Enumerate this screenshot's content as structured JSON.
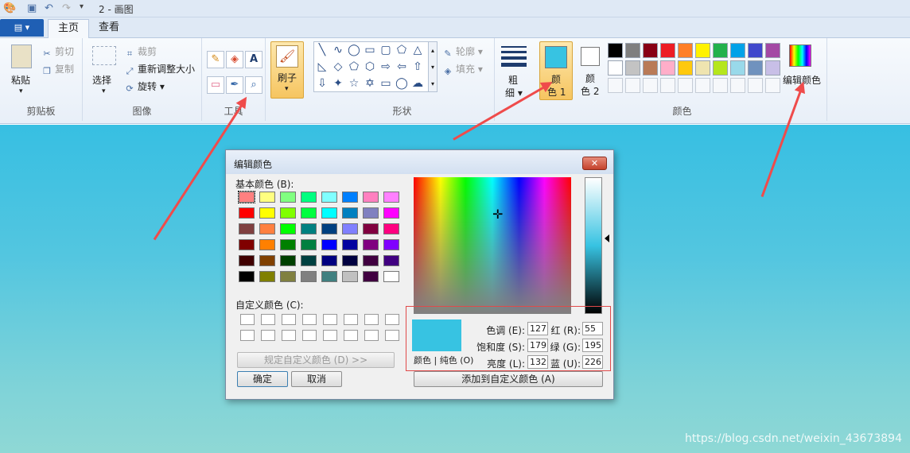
{
  "window": {
    "title": "2 - 画图",
    "file_menu_icon": "file-menu-icon"
  },
  "tabs": [
    {
      "label": "主页",
      "active": true
    },
    {
      "label": "查看",
      "active": false
    }
  ],
  "ribbon": {
    "clipboard": {
      "label": "剪贴板",
      "paste": "粘贴",
      "cut": "剪切",
      "copy": "复制"
    },
    "image": {
      "label": "图像",
      "select": "选择",
      "crop": "裁剪",
      "resize": "重新调整大小",
      "rotate": "旋转"
    },
    "tools": {
      "label": "工具",
      "brush": "刷子"
    },
    "shapes": {
      "label": "形状",
      "outline": "轮廓",
      "fill": "填充"
    },
    "size": {
      "label_line1": "粗",
      "label_line2": "细"
    },
    "colors": {
      "label": "颜色",
      "color1_line1": "颜",
      "color1_line2": "色 1",
      "color2_line1": "颜",
      "color2_line2": "色 2",
      "edit_colors": "编辑颜色",
      "color1_value": "#37c3e2",
      "color2_value": "#ffffff",
      "palette_row1": [
        "#000000",
        "#7f7f7f",
        "#880015",
        "#ed1c24",
        "#ff7f27",
        "#fff200",
        "#22b14c",
        "#00a2e8",
        "#3f48cc",
        "#a349a4"
      ],
      "palette_row2": [
        "#ffffff",
        "#c3c3c3",
        "#b97a57",
        "#ffaec9",
        "#ffc90e",
        "#efe4b0",
        "#b5e61d",
        "#99d9ea",
        "#7092be",
        "#c8bfe7"
      ]
    }
  },
  "dialog": {
    "title": "编辑颜色",
    "basic_colors_label": "基本颜色 (B):",
    "custom_colors_label": "自定义颜色 (C):",
    "define_custom_button": "规定自定义颜色 (D) >>",
    "ok_button": "确定",
    "cancel_button": "取消",
    "add_custom_button": "添加到自定义颜色 (A)",
    "preview_label": "颜色 | 纯色 (O)",
    "hue_label": "色调 (E):",
    "sat_label": "饱和度 (S):",
    "lum_label": "亮度 (L):",
    "red_label": "红 (R):",
    "green_label": "绿 (G):",
    "blue_label": "蓝 (U):",
    "hue": "127",
    "sat": "179",
    "lum": "132",
    "red": "55",
    "green": "195",
    "blue": "226",
    "basic_colors": [
      [
        "#ff8080",
        "#ffff80",
        "#80ff80",
        "#00ff80",
        "#80ffff",
        "#0080ff",
        "#ff80c0",
        "#ff80ff"
      ],
      [
        "#ff0000",
        "#ffff00",
        "#80ff00",
        "#00ff40",
        "#00ffff",
        "#0080c0",
        "#8080c0",
        "#ff00ff"
      ],
      [
        "#804040",
        "#ff8040",
        "#00ff00",
        "#008080",
        "#004080",
        "#8080ff",
        "#800040",
        "#ff0080"
      ],
      [
        "#800000",
        "#ff8000",
        "#008000",
        "#008040",
        "#0000ff",
        "#0000a0",
        "#800080",
        "#8000ff"
      ],
      [
        "#400000",
        "#804000",
        "#004000",
        "#004040",
        "#000080",
        "#000040",
        "#400040",
        "#400080"
      ],
      [
        "#000000",
        "#808000",
        "#808040",
        "#808080",
        "#408080",
        "#c0c0c0",
        "#400040",
        "#ffffff"
      ]
    ]
  },
  "watermark": "https://blog.csdn.net/weixin_43673894"
}
